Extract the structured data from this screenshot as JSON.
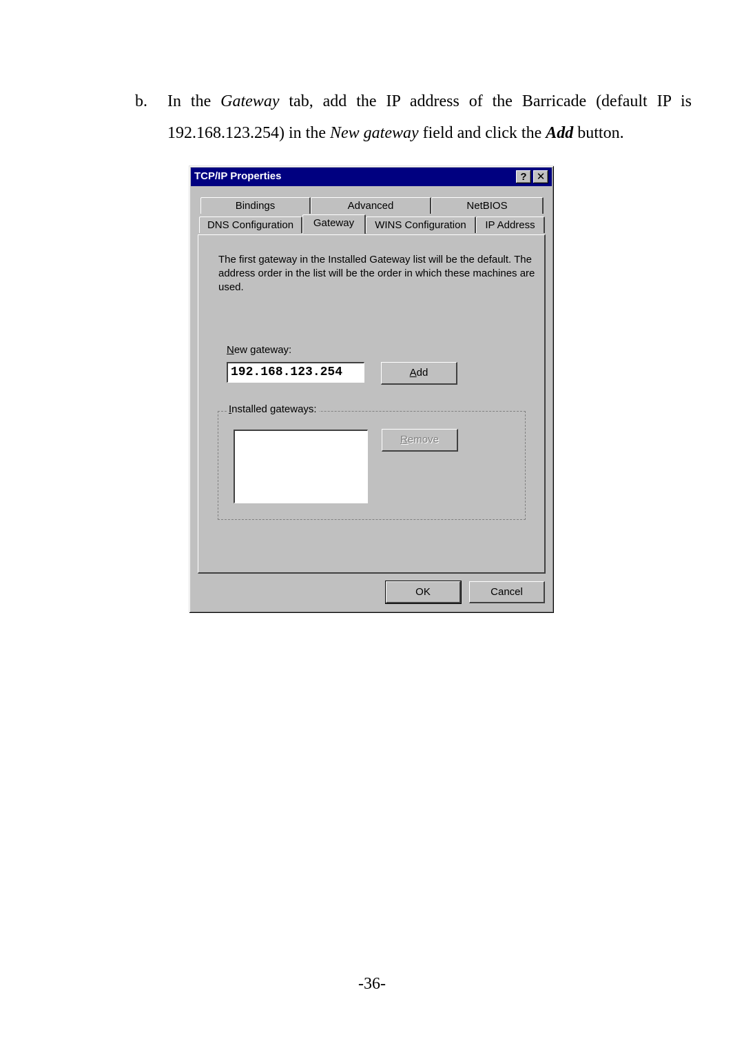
{
  "document": {
    "marker": "b.",
    "line1": [
      {
        "text": "In the ",
        "style": "normal"
      },
      {
        "text": "Gateway",
        "style": "italic"
      },
      {
        "text": " tab, add the IP address of the Barricade (default IP is",
        "style": "normal"
      }
    ],
    "line2": [
      {
        "text": "192.168.123.254) in the ",
        "style": "normal"
      },
      {
        "text": "New gateway",
        "style": "italic"
      },
      {
        "text": " field and click the ",
        "style": "normal"
      },
      {
        "text": "Add",
        "style": "bold-italic"
      },
      {
        "text": " button.",
        "style": "normal"
      }
    ],
    "page_number": "-36-"
  },
  "dialog": {
    "title": "TCP/IP Properties",
    "help_label": "?",
    "close_label": "✕",
    "tabs_row1": [
      "Bindings",
      "Advanced",
      "NetBIOS"
    ],
    "tabs_row2": [
      "DNS Configuration",
      "Gateway",
      "WINS Configuration",
      "IP Address"
    ],
    "active_tab": "Gateway",
    "description": "The first gateway in the Installed Gateway list will be the default. The address order in the list will be the order in which these machines are used.",
    "new_gateway_label": "New gateway:",
    "new_gateway_value": "192.168.123.254",
    "add_label": "Add",
    "installed_label": "Installed gateways:",
    "installed_items": [],
    "remove_label": "Remove",
    "ok_label": "OK",
    "cancel_label": "Cancel"
  }
}
